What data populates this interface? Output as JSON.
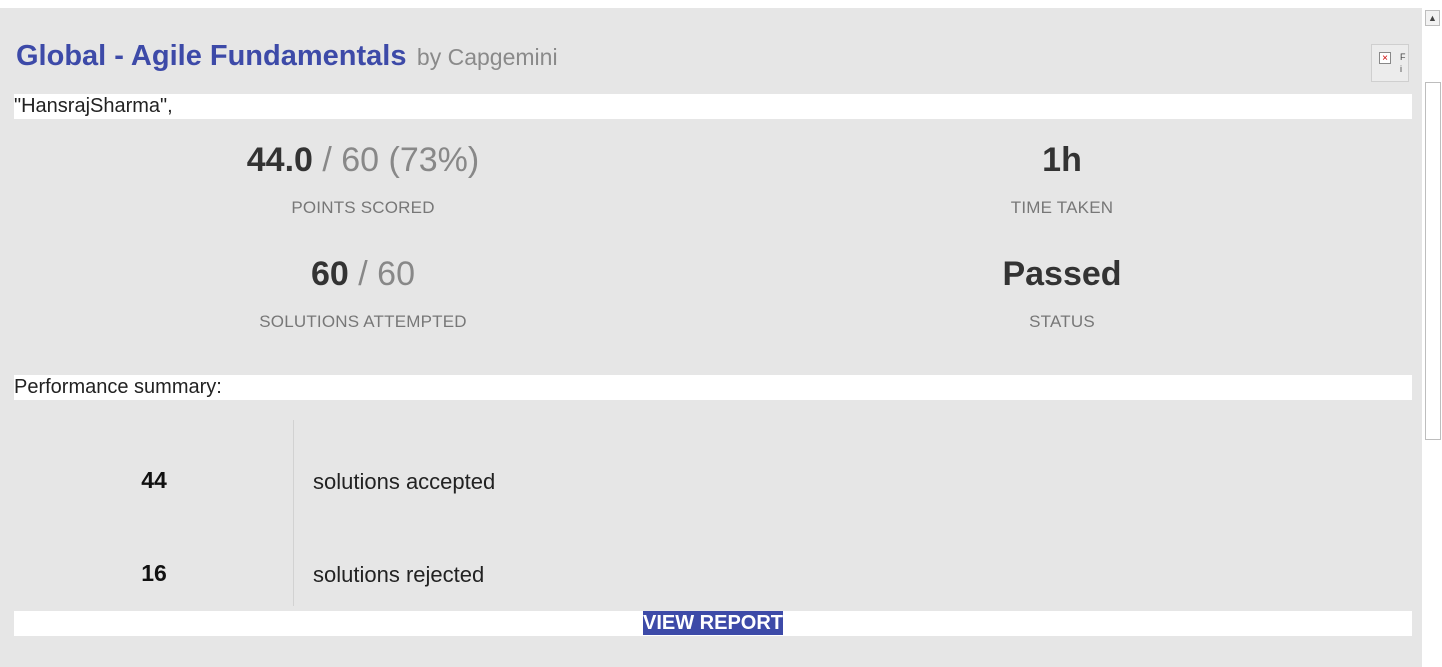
{
  "header": {
    "title": "Global - Agile Fundamentals",
    "byline": "by Capgemini",
    "image_icon": "broken-image-icon",
    "image_alt_partial": "F i"
  },
  "candidate": {
    "name": "\"HansrajSharma\","
  },
  "stats": {
    "points": {
      "scored": "44.0",
      "total": " / 60 (73%)",
      "label": "POINTS SCORED"
    },
    "time": {
      "value": "1h",
      "label": "TIME TAKEN"
    },
    "solutions": {
      "attempted": "60",
      "total": " / 60",
      "label": "SOLUTIONS ATTEMPTED"
    },
    "status": {
      "value": "Passed",
      "label": "STATUS"
    }
  },
  "performance": {
    "heading": "Performance summary:",
    "rows": [
      {
        "count": "44",
        "label": "solutions accepted"
      },
      {
        "count": "16",
        "label": "solutions rejected"
      }
    ]
  },
  "actions": {
    "view_report": "VIEW REPORT"
  },
  "colors": {
    "accent": "#3d4aa8",
    "panel_bg": "#e6e6e6",
    "muted": "#888888"
  }
}
